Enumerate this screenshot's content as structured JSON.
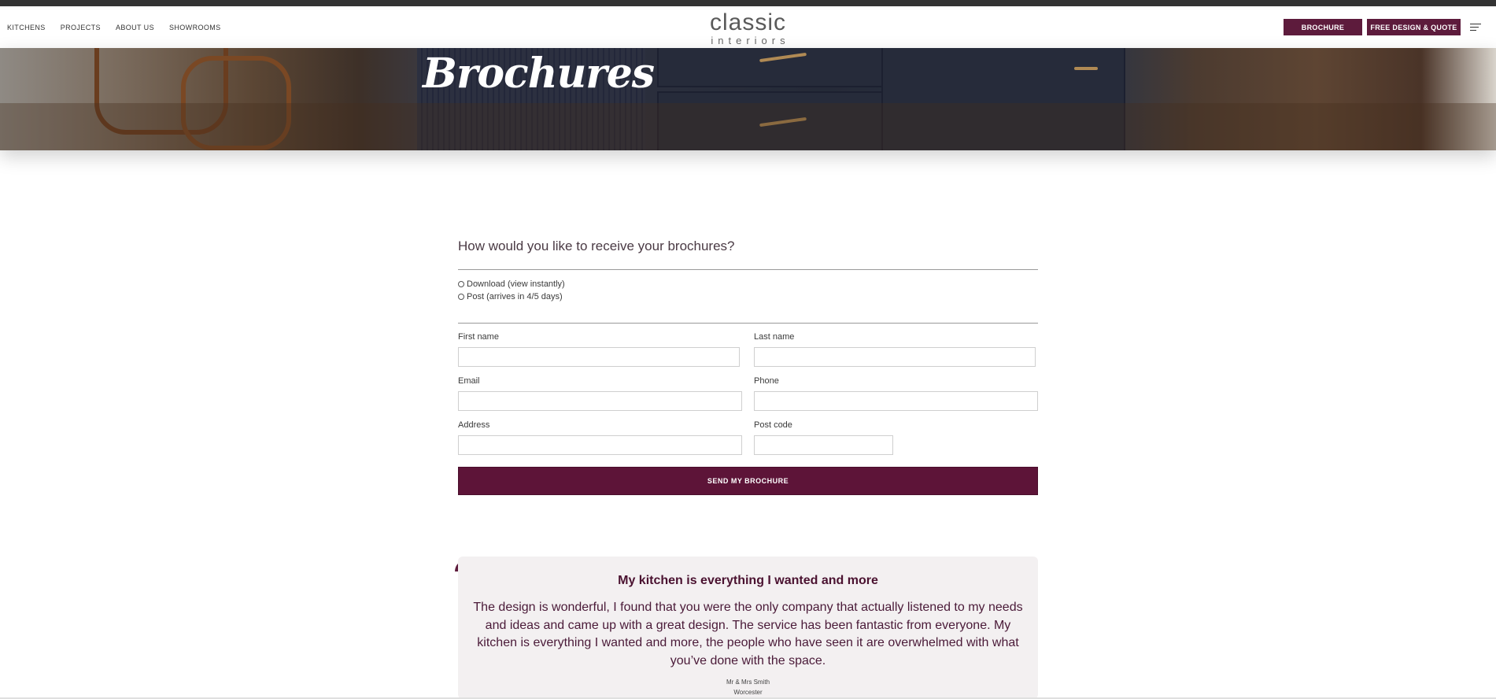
{
  "header": {
    "nav": [
      "KITCHENS",
      "PROJECTS",
      "ABOUT US",
      "SHOWROOMS"
    ],
    "logo_main": "classic",
    "logo_sub": "interiors",
    "brochure_label": "BROCHURE",
    "quote_label": "FREE DESIGN & QUOTE",
    "menu_icon": "hamburger-menu-icon"
  },
  "hero": {
    "title": "Brochures"
  },
  "form": {
    "question": "How would you like to receive your brochures?",
    "options": [
      "Download (view instantly)",
      "Post (arrives in 4/5 days)"
    ],
    "first_name_label": "First name",
    "last_name_label": "Last name",
    "email_label": "Email",
    "phone_label": "Phone",
    "address_label": "Address",
    "postcode_label": "Post code",
    "submit_label": "SEND MY BROCHURE"
  },
  "testimonial": {
    "quote_mark": "“",
    "title": "My kitchen is everything I wanted and more",
    "body": "The design is wonderful, I found that you were the only company that actually listened to my needs and ideas and came up with a great design. The service has been fantastic from everyone. My kitchen is everything I wanted and more, the people who have seen it are overwhelmed with what you’ve done with the space.",
    "name": "Mr & Mrs Smith",
    "location": "Worcester"
  },
  "colors": {
    "brand": "#5d1b3c",
    "submit": "#5d1438",
    "testimonial_bg": "#f3f0f1"
  }
}
